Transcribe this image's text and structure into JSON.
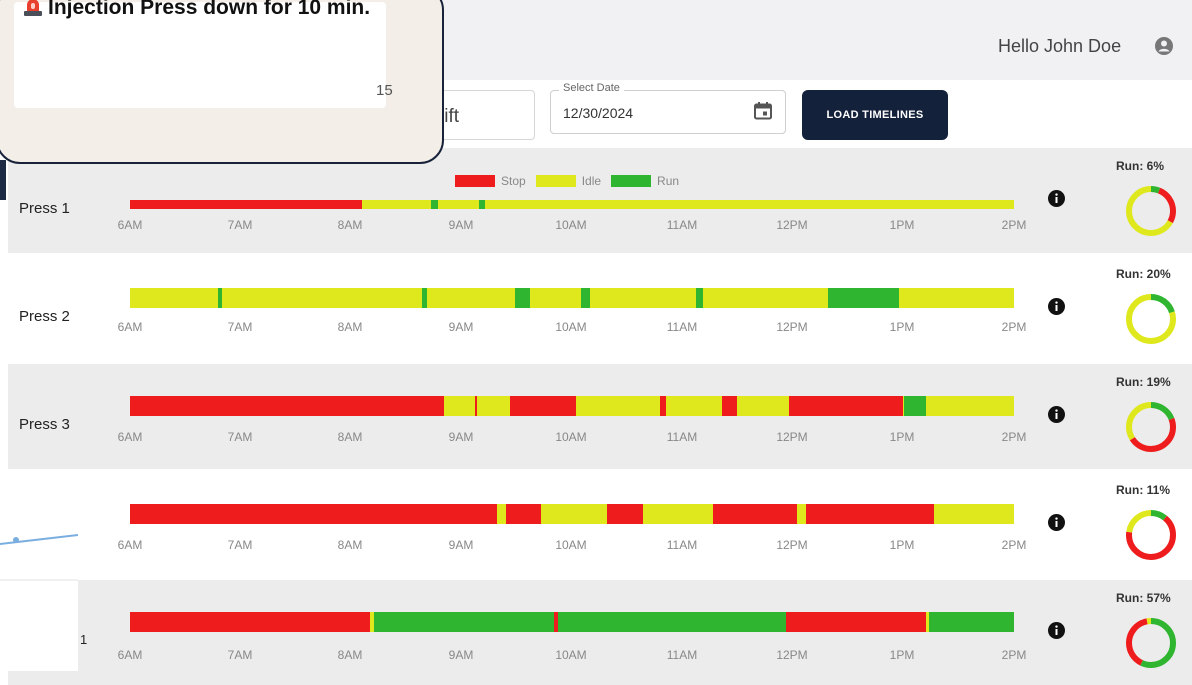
{
  "header": {
    "greeting": "Hello John Doe",
    "user_icon": "account-circle-icon"
  },
  "filters": {
    "shift_text": "Shift",
    "date_label": "Select Date",
    "date_value": "12/30/2024",
    "calendar_icon": "calendar-icon",
    "load_button": "LOAD TIMELINES"
  },
  "legend": [
    {
      "label": "Stop",
      "color": "#ee1c1c"
    },
    {
      "label": "Idle",
      "color": "#dfe81d"
    },
    {
      "label": "Run",
      "color": "#2fb52f"
    }
  ],
  "colors": {
    "stop": "#ee1c1c",
    "idle": "#dfe81d",
    "run": "#2fb52f"
  },
  "time_ticks": [
    "6AM",
    "7AM",
    "8AM",
    "9AM",
    "10AM",
    "11AM",
    "12PM",
    "1PM",
    "2PM"
  ],
  "machines": [
    {
      "label": "Press 1",
      "run_text": "Run: 6%",
      "run_pct": 6,
      "stop_pct": 27,
      "idle_pct": 67,
      "timeline": [
        [
          "stop",
          0,
          0.263
        ],
        [
          "idle",
          0.263,
          0.34
        ],
        [
          "run",
          0.34,
          0.348
        ],
        [
          "idle",
          0.348,
          0.395
        ],
        [
          "run",
          0.395,
          0.402
        ],
        [
          "idle",
          0.402,
          1
        ]
      ]
    },
    {
      "label": "Press 2",
      "run_text": "Run: 20%",
      "run_pct": 20,
      "stop_pct": 0,
      "idle_pct": 80,
      "timeline": [
        [
          "idle",
          0,
          0.1
        ],
        [
          "run",
          0.1,
          0.104
        ],
        [
          "idle",
          0.104,
          0.33
        ],
        [
          "run",
          0.33,
          0.336
        ],
        [
          "idle",
          0.336,
          0.435
        ],
        [
          "run",
          0.435,
          0.452
        ],
        [
          "idle",
          0.452,
          0.51
        ],
        [
          "run",
          0.51,
          0.52
        ],
        [
          "idle",
          0.52,
          0.64
        ],
        [
          "run",
          0.64,
          0.648
        ],
        [
          "idle",
          0.648,
          0.79
        ],
        [
          "run",
          0.79,
          0.87
        ],
        [
          "idle",
          0.87,
          1
        ]
      ]
    },
    {
      "label": "Press 3",
      "run_text": "Run: 19%",
      "run_pct": 19,
      "stop_pct": 47,
      "idle_pct": 34,
      "timeline": [
        [
          "stop",
          0,
          0.355
        ],
        [
          "idle",
          0.355,
          0.39
        ],
        [
          "stop",
          0.39,
          0.393
        ],
        [
          "idle",
          0.393,
          0.43
        ],
        [
          "stop",
          0.43,
          0.505
        ],
        [
          "idle",
          0.505,
          0.6
        ],
        [
          "stop",
          0.6,
          0.606
        ],
        [
          "idle",
          0.606,
          0.67
        ],
        [
          "stop",
          0.67,
          0.687
        ],
        [
          "idle",
          0.687,
          0.745
        ],
        [
          "stop",
          0.745,
          0.875
        ],
        [
          "run",
          0.875,
          0.9
        ],
        [
          "idle",
          0.9,
          1
        ]
      ]
    },
    {
      "label": "",
      "run_text": "Run: 11%",
      "run_pct": 11,
      "stop_pct": 66,
      "idle_pct": 23,
      "timeline": [
        [
          "stop",
          0,
          0.415
        ],
        [
          "idle",
          0.415,
          0.425
        ],
        [
          "stop",
          0.425,
          0.465
        ],
        [
          "idle",
          0.465,
          0.54
        ],
        [
          "stop",
          0.54,
          0.58
        ],
        [
          "idle",
          0.58,
          0.66
        ],
        [
          "stop",
          0.66,
          0.755
        ],
        [
          "idle",
          0.755,
          0.765
        ],
        [
          "stop",
          0.765,
          0.91
        ],
        [
          "idle",
          0.91,
          1
        ]
      ]
    },
    {
      "label": "",
      "run_text": "Run: 57%",
      "run_pct": 57,
      "stop_pct": 40,
      "idle_pct": 3,
      "timeline": [
        [
          "stop",
          0,
          0.272
        ],
        [
          "idle",
          0.272,
          0.276
        ],
        [
          "run",
          0.276,
          0.48
        ],
        [
          "stop",
          0.48,
          0.484
        ],
        [
          "run",
          0.484,
          0.742
        ],
        [
          "stop",
          0.742,
          0.9
        ],
        [
          "idle",
          0.9,
          0.904
        ],
        [
          "run",
          0.904,
          1
        ]
      ]
    }
  ],
  "info_icon": "info-icon",
  "side": {
    "number": "1"
  },
  "notification": {
    "icon": "siren-icon",
    "title": "Injection Press down for 10 min.",
    "count": "15"
  }
}
